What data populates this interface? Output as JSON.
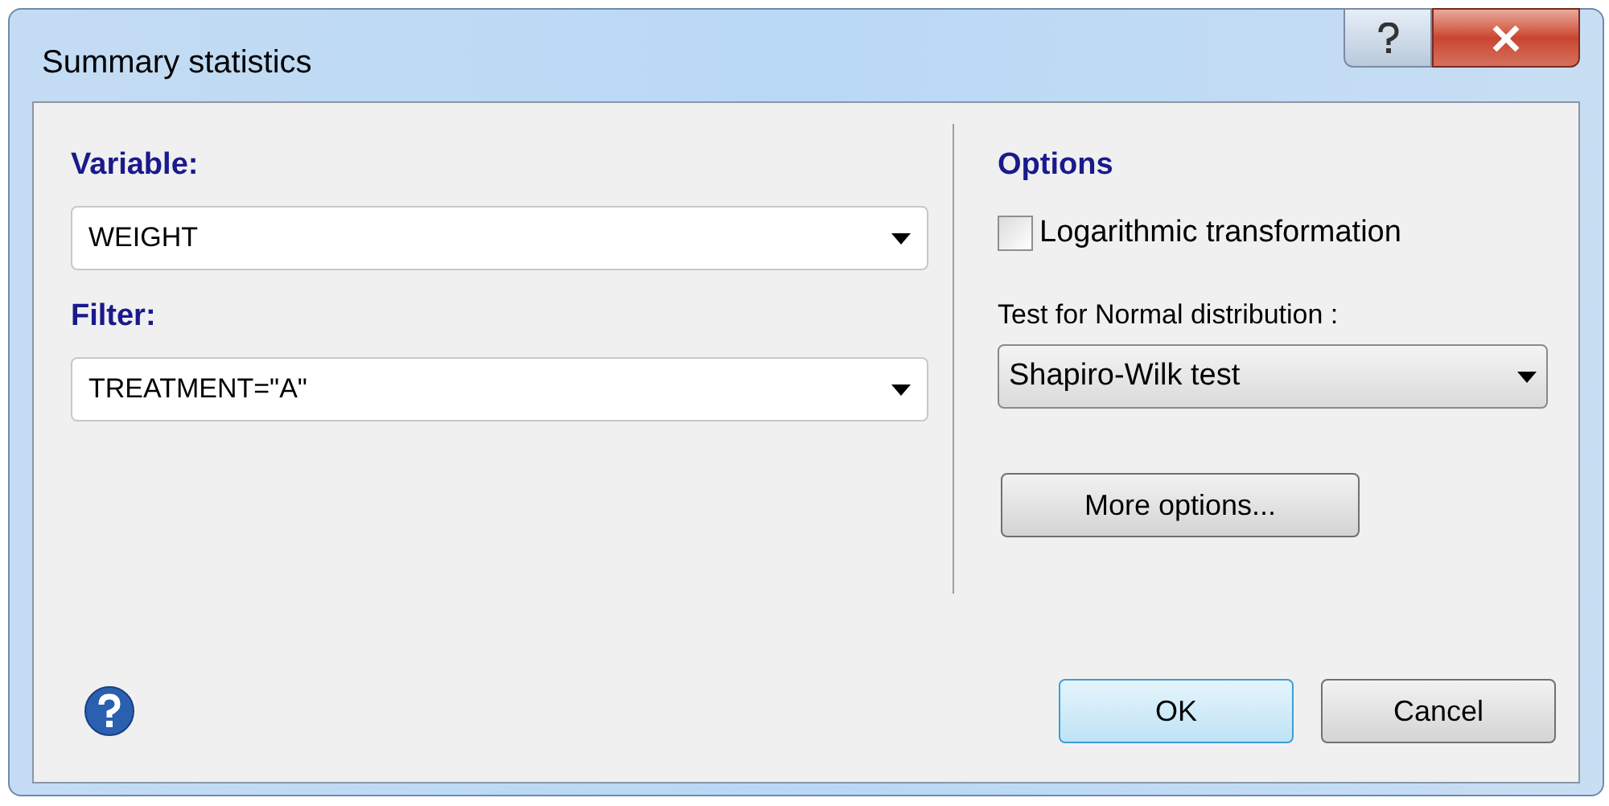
{
  "window": {
    "title": "Summary statistics"
  },
  "fields": [
    {
      "label": "Variable:",
      "value": "WEIGHT"
    },
    {
      "label": "Filter:",
      "value": "TREATMENT=\"A\""
    }
  ],
  "options": {
    "heading": "Options",
    "log_transform": {
      "label": "Logarithmic transformation",
      "checked": false
    },
    "normal_test": {
      "label": "Test for Normal distribution :",
      "value": "Shapiro-Wilk test"
    },
    "more_button": "More options..."
  },
  "buttons": [
    {
      "label": "OK",
      "default": true
    },
    {
      "label": "Cancel",
      "default": false
    }
  ]
}
